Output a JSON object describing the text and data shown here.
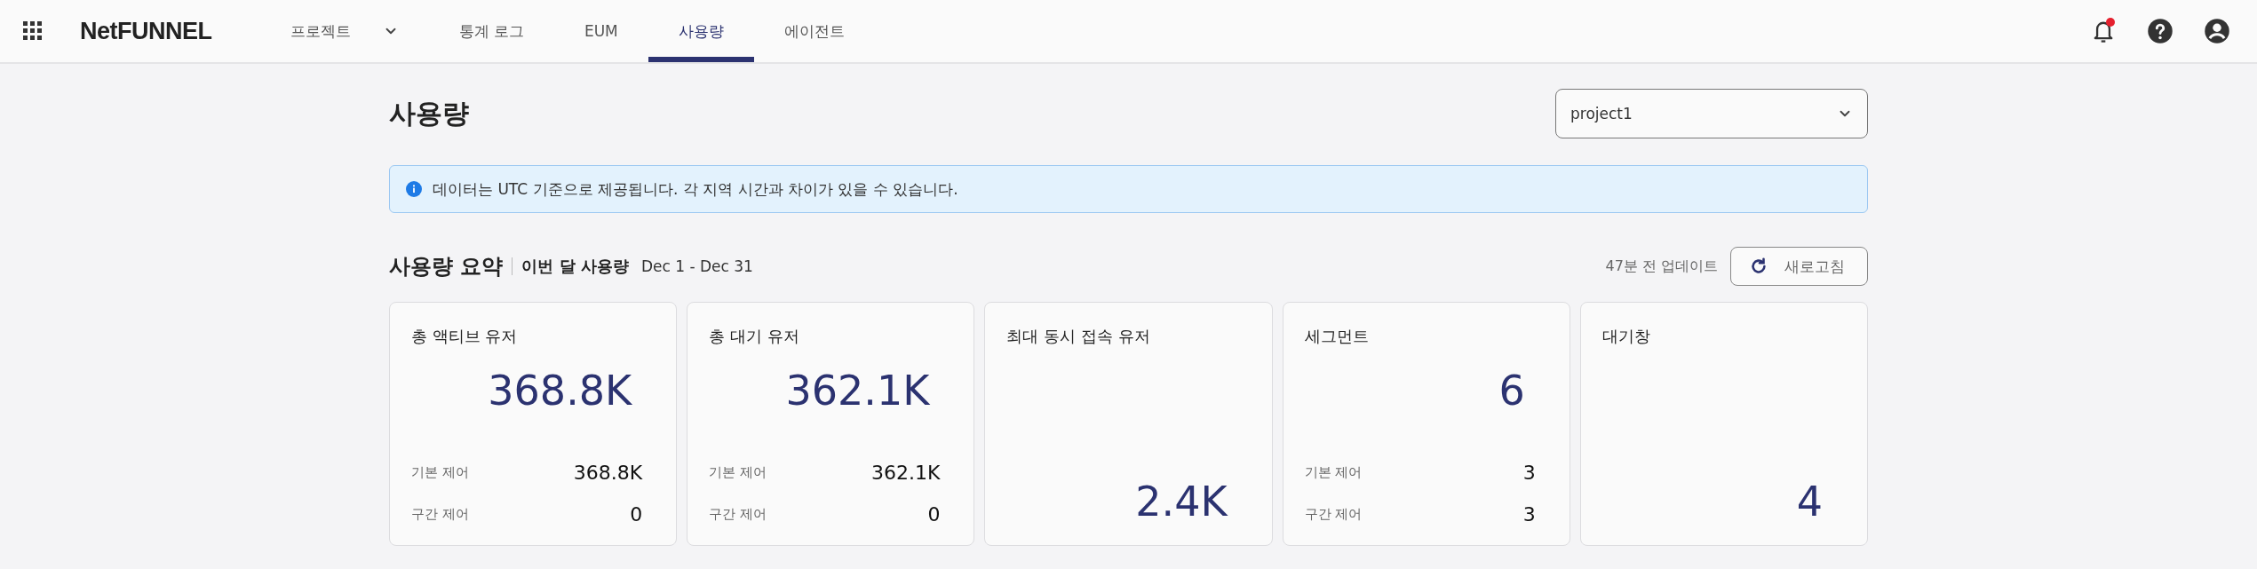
{
  "header": {
    "logo": "NetFUNNEL",
    "nav": [
      {
        "label": "프로젝트",
        "kind": "dropdown",
        "selected": false
      },
      {
        "label": "통계 로그",
        "kind": "link",
        "selected": false
      },
      {
        "label": "EUM",
        "kind": "link",
        "selected": false
      },
      {
        "label": "사용량",
        "kind": "link",
        "selected": true
      },
      {
        "label": "에이전트",
        "kind": "link",
        "selected": false
      }
    ],
    "notification_unread": true
  },
  "page": {
    "title": "사용량",
    "project_select": {
      "value": "project1"
    },
    "notice": "데이터는 UTC 기준으로 제공됩니다. 각 지역 시간과 차이가 있을 수 있습니다.",
    "summary": {
      "title": "사용량 요약",
      "subtitle": "이번 달 사용량",
      "range": "Dec 1 - Dec 31",
      "updated": "47분 전 업데이트",
      "refresh": "새로고침"
    },
    "cards": [
      {
        "title": "총 액티브 유저",
        "value": "368.8K",
        "rows": [
          {
            "label": "기본 제어",
            "value": "368.8K"
          },
          {
            "label": "구간 제어",
            "value": "0"
          }
        ]
      },
      {
        "title": "총 대기 유저",
        "value": "362.1K",
        "rows": [
          {
            "label": "기본 제어",
            "value": "362.1K"
          },
          {
            "label": "구간 제어",
            "value": "0"
          }
        ]
      },
      {
        "title": "최대 동시 접속 유저",
        "value": "2.4K"
      },
      {
        "title": "세그먼트",
        "value": "6",
        "rows": [
          {
            "label": "기본 제어",
            "value": "3"
          },
          {
            "label": "구간 제어",
            "value": "3"
          }
        ]
      },
      {
        "title": "대기창",
        "value": "4"
      }
    ]
  }
}
